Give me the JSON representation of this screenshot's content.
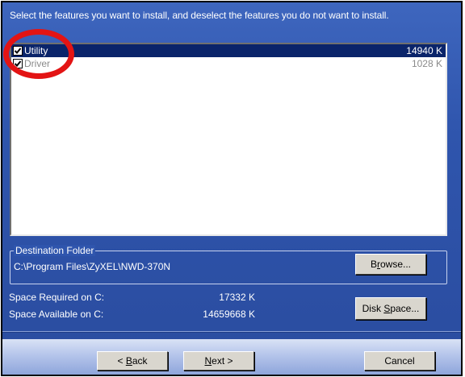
{
  "instruction": "Select the features you want to install, and deselect the features you do not want to install.",
  "features": [
    {
      "label": "Utility",
      "size": "14940 K",
      "checked": true,
      "selected": true
    },
    {
      "label": "Driver",
      "size": "1028 K",
      "checked": true,
      "selected": false
    }
  ],
  "destination": {
    "legend": "Destination Folder",
    "path": "C:\\Program Files\\ZyXEL\\NWD-370N",
    "browse_prefix": "B",
    "browse_accel": "r",
    "browse_suffix": "owse..."
  },
  "space": {
    "required_label": "Space Required on C:",
    "required_value": "17332 K",
    "available_label": "Space Available on C:",
    "available_value": "14659668 K",
    "disk_prefix": "Disk ",
    "disk_accel": "S",
    "disk_suffix": "pace..."
  },
  "nav": {
    "back_prefix": "< ",
    "back_accel": "B",
    "back_suffix": "ack",
    "next_accel": "N",
    "next_suffix": "ext >",
    "cancel_label": "Cancel"
  },
  "colors": {
    "dialog_bg": "#2f55ad",
    "selection": "#0a246a",
    "annotation": "#e31414"
  }
}
